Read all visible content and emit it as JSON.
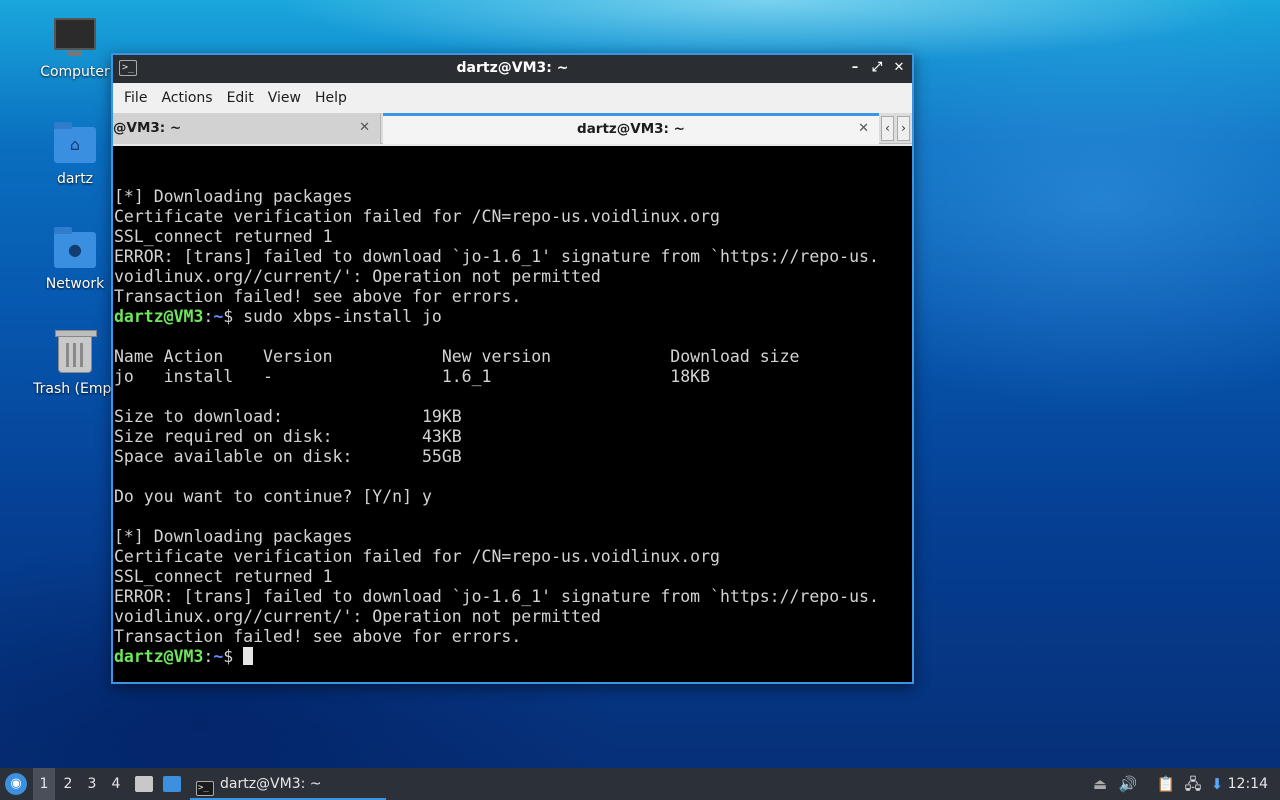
{
  "desktop": {
    "icons": [
      {
        "label": "Computer",
        "icon": "computer-icon"
      },
      {
        "label": "dartz",
        "icon": "home-folder-icon"
      },
      {
        "label": "Network",
        "icon": "network-folder-icon"
      },
      {
        "label": "Trash (Empt",
        "icon": "trash-icon"
      }
    ]
  },
  "window": {
    "title": "dartz@VM3: ~",
    "menu": [
      "File",
      "Actions",
      "Edit",
      "View",
      "Help"
    ],
    "tabs": [
      {
        "label": "@VM3: ~",
        "active": false
      },
      {
        "label": "dartz@VM3: ~",
        "active": true
      }
    ],
    "accent": "#3b95e3"
  },
  "terminal": {
    "prompt_user": "dartz@VM3",
    "prompt_path": "~",
    "command": "sudo xbps-install jo",
    "lines": [
      "[*] Downloading packages",
      "Certificate verification failed for /CN=repo-us.voidlinux.org",
      "SSL_connect returned 1",
      "ERROR: [trans] failed to download `jo-1.6_1' signature from `https://repo-us.",
      "voidlinux.org//current/': Operation not permitted",
      "Transaction failed! see above for errors.",
      "",
      "",
      "Name Action    Version           New version            Download size",
      "jo   install   -                 1.6_1                  18KB",
      "",
      "Size to download:              19KB",
      "Size required on disk:         43KB",
      "Space available on disk:       55GB",
      "",
      "Do you want to continue? [Y/n] y",
      "",
      "[*] Downloading packages",
      "Certificate verification failed for /CN=repo-us.voidlinux.org",
      "SSL_connect returned 1",
      "ERROR: [trans] failed to download `jo-1.6_1' signature from `https://repo-us.",
      "voidlinux.org//current/': Operation not permitted",
      "Transaction failed! see above for errors."
    ]
  },
  "taskbar": {
    "workspaces": [
      "1",
      "2",
      "3",
      "4"
    ],
    "active_workspace": "1",
    "task_label": "dartz@VM3: ~",
    "clock": "12:14"
  }
}
